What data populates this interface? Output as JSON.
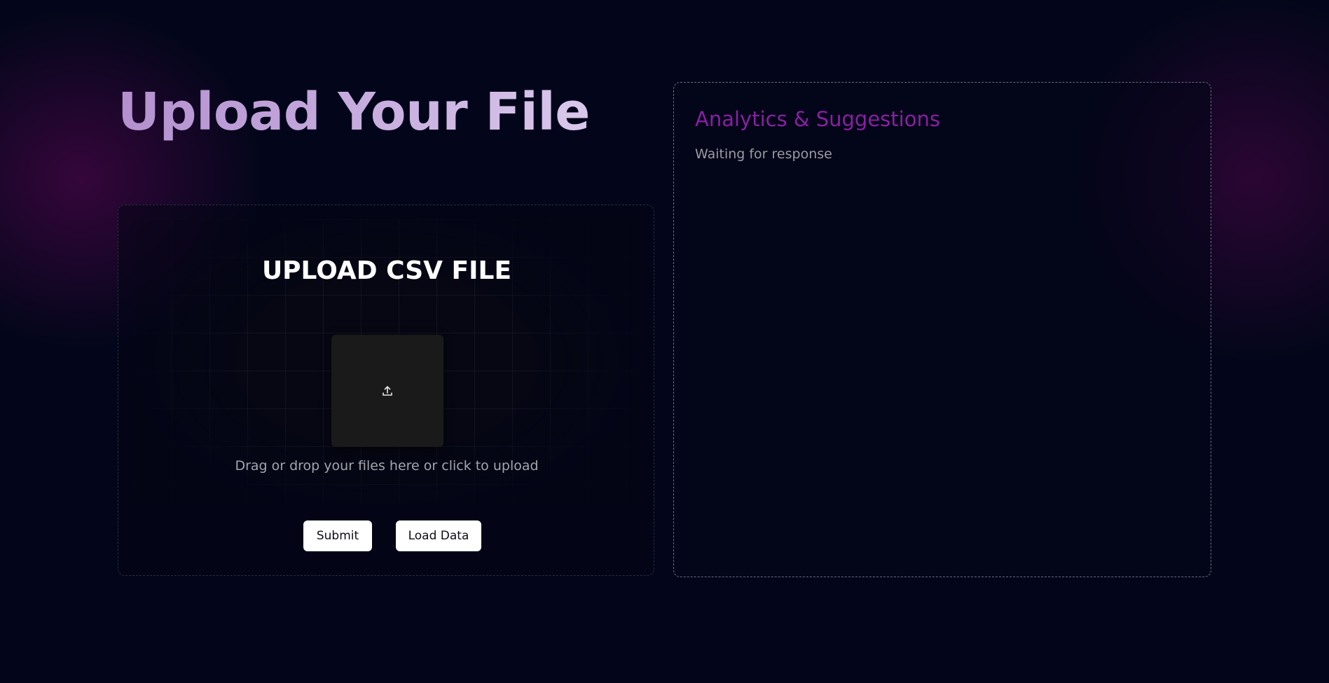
{
  "header": {
    "title": "Upload Your File"
  },
  "upload": {
    "heading": "UPLOAD CSV FILE",
    "hint": "Drag or drop your files here or click to upload",
    "icon": "upload-icon",
    "submit_label": "Submit",
    "load_label": "Load Data"
  },
  "analytics": {
    "title": "Analytics & Suggestions",
    "status": "Waiting for response"
  },
  "colors": {
    "background": "#03061a",
    "title_gradient_start": "#b38fcf",
    "title_gradient_end": "#d9c8ec",
    "accent_purple": "#8a1fa3",
    "button_bg": "#ffffff",
    "upload_box_bg": "#1a1a1a"
  }
}
